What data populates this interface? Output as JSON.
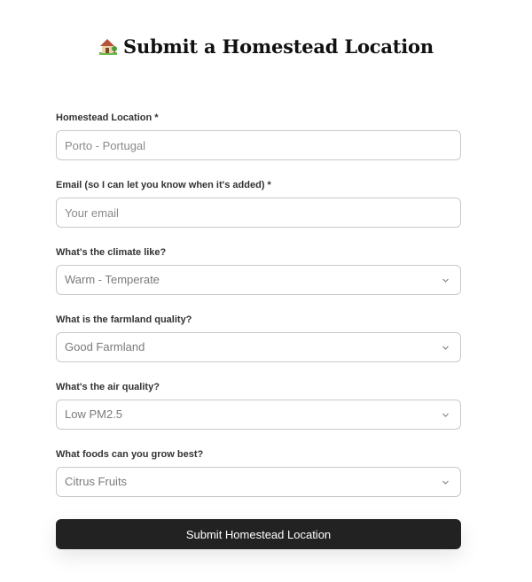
{
  "header": {
    "icon": "house-with-garden-icon",
    "title": "Submit a Homestead Location"
  },
  "form": {
    "location": {
      "label": "Homestead Location *",
      "placeholder": "Porto - Portugal"
    },
    "email": {
      "label": "Email (so I can let you know when it's added) *",
      "placeholder": "Your email"
    },
    "climate": {
      "label": "What's the climate like?",
      "value": "Warm - Temperate"
    },
    "farmland": {
      "label": "What is the farmland quality?",
      "value": "Good Farmland"
    },
    "air": {
      "label": "What's the air quality?",
      "value": "Low PM2.5"
    },
    "foods": {
      "label": "What foods can you grow best?",
      "value": "Citrus Fruits"
    },
    "submit_label": "Submit Homestead Location"
  },
  "colors": {
    "button_bg": "#222222",
    "border": "#c9c9c9",
    "text_muted": "#7a7a7a"
  }
}
